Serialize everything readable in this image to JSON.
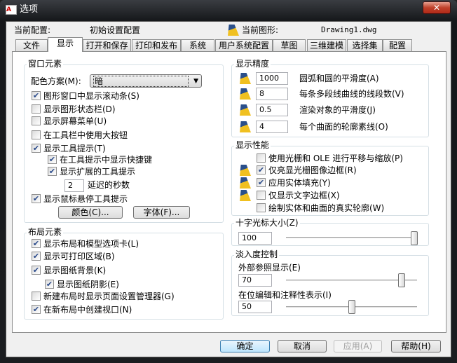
{
  "title": "选项",
  "header": {
    "profile_label": "当前配置:",
    "profile_value": "初始设置配置",
    "drawing_label": "当前图形:",
    "drawing_value": "Drawing1.dwg"
  },
  "tabs": [
    "文件",
    "显示",
    "打开和保存",
    "打印和发布",
    "系统",
    "用户系统配置",
    "草图",
    "三维建模",
    "选择集",
    "配置"
  ],
  "window_elements": {
    "title": "窗口元素",
    "color_scheme_label": "配色方案(M):",
    "color_scheme_value": "暗",
    "items": [
      {
        "label": "图形窗口中显示滚动条(S)",
        "checked": true
      },
      {
        "label": "显示图形状态栏(D)",
        "checked": false
      },
      {
        "label": "显示屏幕菜单(U)",
        "checked": false
      },
      {
        "label": "在工具栏中使用大按钮",
        "checked": false
      },
      {
        "label": "显示工具提示(T)",
        "checked": true
      },
      {
        "label": "在工具提示中显示快捷键",
        "checked": true
      },
      {
        "label": "显示扩展的工具提示",
        "checked": true
      },
      {
        "label": "显示鼠标悬停工具提示",
        "checked": true
      }
    ],
    "delay_value": "2",
    "delay_label": "延迟的秒数",
    "colors_button": "颜色(C)...",
    "fonts_button": "字体(F)..."
  },
  "layout_elements": {
    "title": "布局元素",
    "items": [
      {
        "label": "显示布局和模型选项卡(L)",
        "checked": true
      },
      {
        "label": "显示可打印区域(B)",
        "checked": true
      },
      {
        "label": "显示图纸背景(K)",
        "checked": true
      },
      {
        "label": "显示图纸阴影(E)",
        "checked": true
      },
      {
        "label": "新建布局时显示页面设置管理器(G)",
        "checked": false
      },
      {
        "label": "在新布局中创建视口(N)",
        "checked": true
      }
    ]
  },
  "resolution": {
    "title": "显示精度",
    "items": [
      {
        "value": "1000",
        "label": "圆弧和圆的平滑度(A)"
      },
      {
        "value": "8",
        "label": "每条多段线曲线的线段数(V)"
      },
      {
        "value": "0.5",
        "label": "渲染对象的平滑度(J)"
      },
      {
        "value": "4",
        "label": "每个曲面的轮廓素线(O)"
      }
    ]
  },
  "performance": {
    "title": "显示性能",
    "items": [
      {
        "label": "使用光栅和 OLE 进行平移与缩放(P)",
        "checked": false
      },
      {
        "label": "仅亮显光栅图像边框(R)",
        "checked": true
      },
      {
        "label": "应用实体填充(Y)",
        "checked": true
      },
      {
        "label": "仅显示文字边框(X)",
        "checked": false
      },
      {
        "label": "绘制实体和曲面的真实轮廓(W)",
        "checked": false
      }
    ]
  },
  "crosshair": {
    "title": "十字光标大小(Z)",
    "value": "100",
    "slider_percent": 100
  },
  "fade": {
    "title": "淡入度控制",
    "xref_label": "外部参照显示(E)",
    "xref_value": "70",
    "xref_percent": 90,
    "inplace_label": "在位编辑和注释性表示(I)",
    "inplace_value": "50",
    "inplace_percent": 50
  },
  "buttons": {
    "ok": "确定",
    "cancel": "取消",
    "apply": "应用(A)",
    "help": "帮助(H)"
  }
}
